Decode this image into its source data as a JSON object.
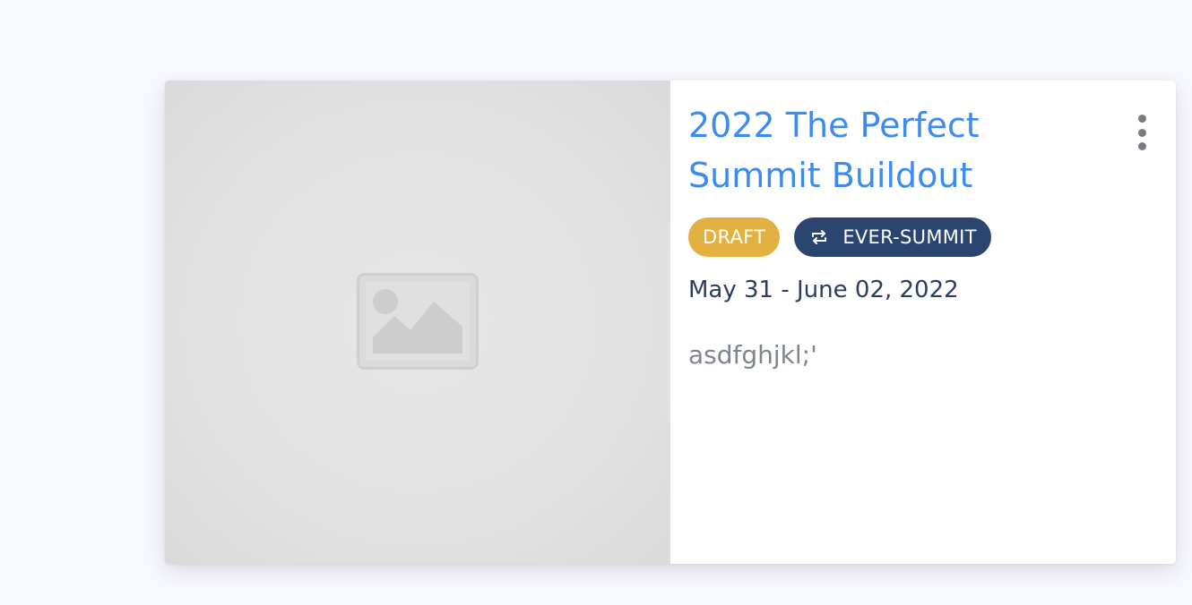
{
  "event": {
    "title": "2022 The Perfect Summit Buildout",
    "status_badge": "DRAFT",
    "type_badge": "EVER-SUMMIT",
    "date_range": "May 31 - June 02, 2022",
    "description": "asdfghjkl;'"
  },
  "icons": {
    "thumbnail": "image-placeholder-icon",
    "type": "repeat-icon",
    "menu": "kebab-menu-icon"
  },
  "colors": {
    "title": "#3d8bef",
    "draft_badge": "#e2b141",
    "ever_summit_badge": "#2a4670",
    "date_text": "#2b3e61",
    "description_text": "#7e8591",
    "page_background": "#f7f8fc"
  }
}
